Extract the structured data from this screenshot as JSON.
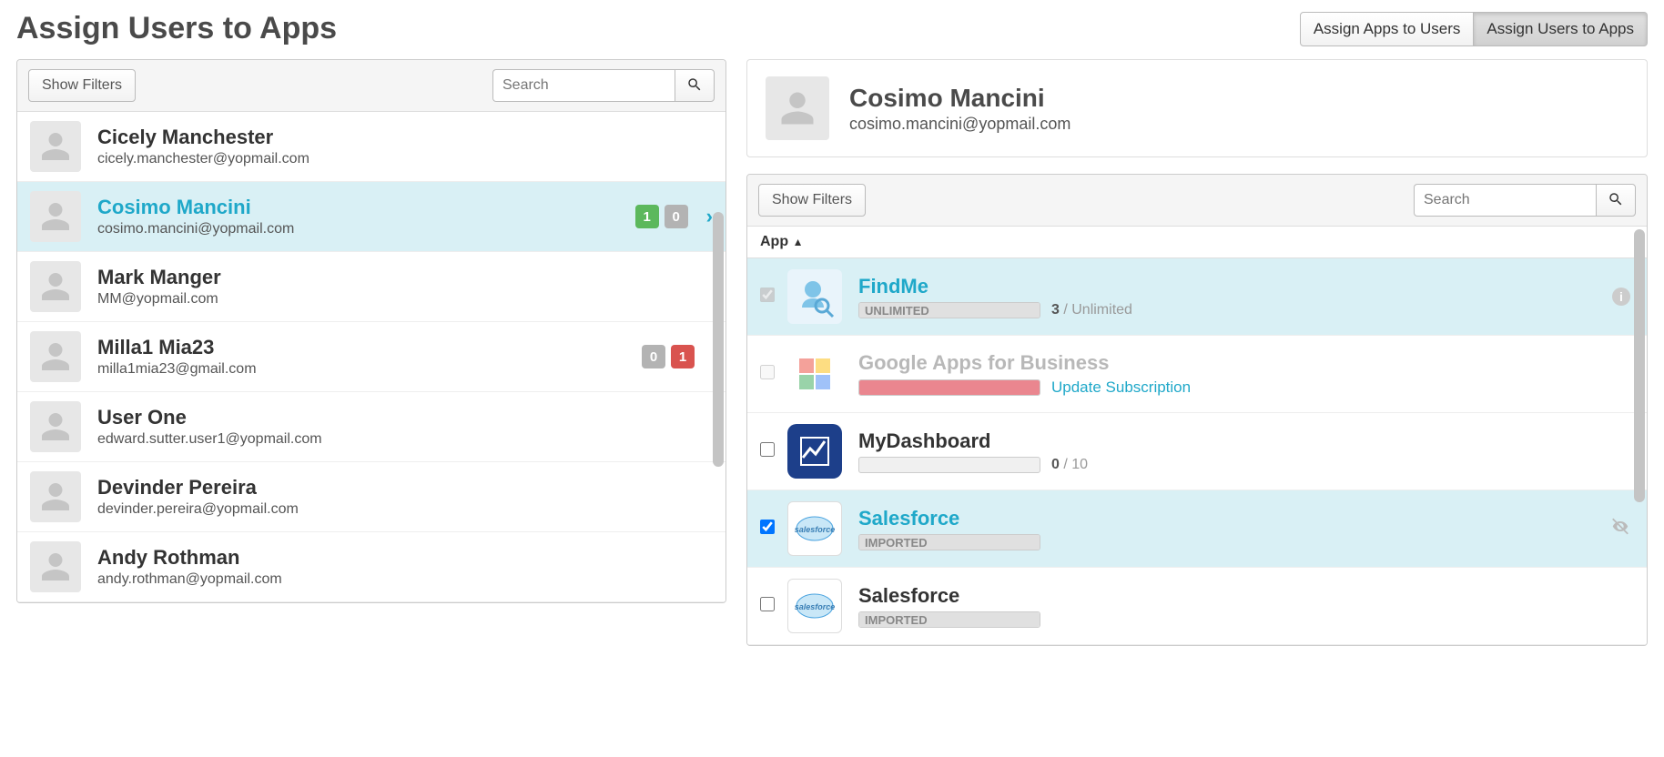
{
  "page_title": "Assign Users to Apps",
  "toggle": {
    "left": "Assign Apps to Users",
    "right": "Assign Users to Apps"
  },
  "left": {
    "show_filters": "Show Filters",
    "search_placeholder": "Search",
    "users": [
      {
        "name": "Cicely Manchester",
        "email": "cicely.manchester@yopmail.com"
      },
      {
        "name": "Cosimo Mancini",
        "email": "cosimo.mancini@yopmail.com",
        "selected": true,
        "badge_green": "1",
        "badge_gray": "0"
      },
      {
        "name": "Mark Manger",
        "email": "MM@yopmail.com"
      },
      {
        "name": "Milla1 Mia23",
        "email": "milla1mia23@gmail.com",
        "badge_gray": "0",
        "badge_red": "1"
      },
      {
        "name": "User One",
        "email": "edward.sutter.user1@yopmail.com"
      },
      {
        "name": "Devinder Pereira",
        "email": "devinder.pereira@yopmail.com"
      },
      {
        "name": "Andy Rothman",
        "email": "andy.rothman@yopmail.com"
      }
    ]
  },
  "detail": {
    "name": "Cosimo Mancini",
    "email": "cosimo.mancini@yopmail.com"
  },
  "right": {
    "show_filters": "Show Filters",
    "search_placeholder": "Search",
    "column_header": "App",
    "apps": [
      {
        "name": "FindMe",
        "progress_label": "UNLIMITED",
        "usage_count": "3",
        "usage_total": " / Unlimited"
      },
      {
        "name": "Google Apps for Business",
        "update_link": "Update Subscription"
      },
      {
        "name": "MyDashboard",
        "usage_count": "0",
        "usage_total": " / 10"
      },
      {
        "name": "Salesforce",
        "progress_label": "IMPORTED"
      },
      {
        "name": "Salesforce",
        "progress_label": "IMPORTED"
      }
    ]
  }
}
